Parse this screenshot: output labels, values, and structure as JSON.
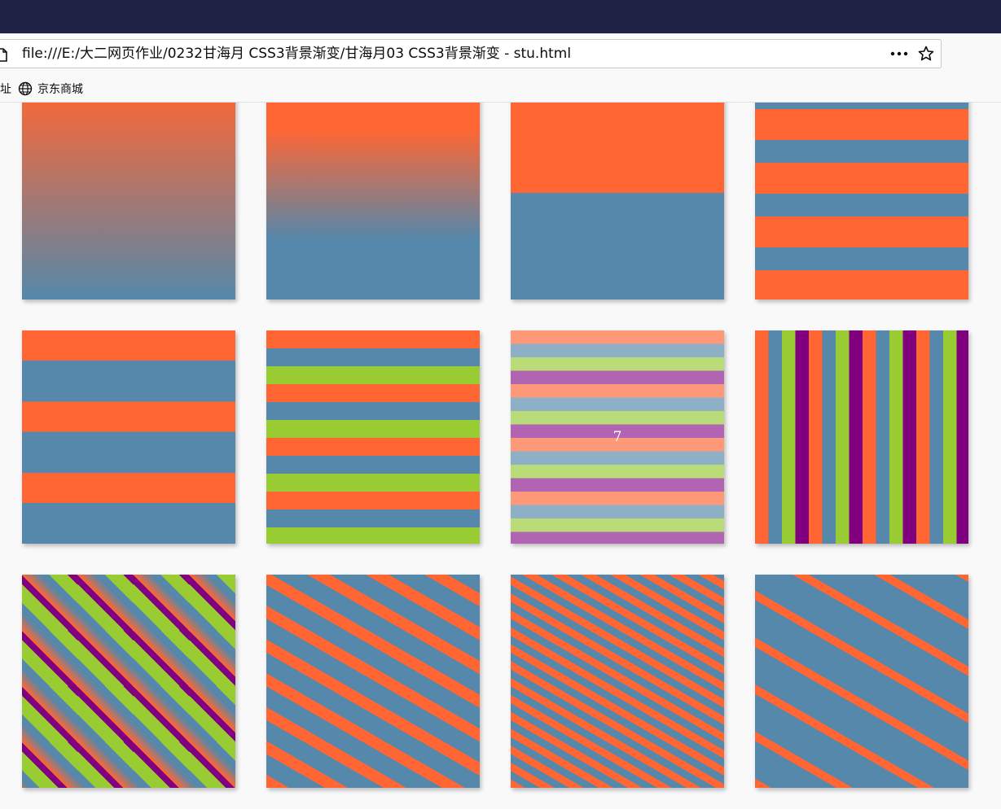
{
  "browser": {
    "address": "file:///E:/大二网页作业/0232甘海月 CSS3背景渐变/甘海月03 CSS3背景渐变 - stu.html",
    "bookmark_partial": "址",
    "bookmarks": [
      {
        "label": "京东商城",
        "icon": "globe-icon"
      }
    ]
  },
  "page": {
    "boxes": [
      {
        "label": ""
      },
      {
        "label": ""
      },
      {
        "label": ""
      },
      {
        "label": ""
      },
      {
        "label": ""
      },
      {
        "label": ""
      },
      {
        "label": "7"
      },
      {
        "label": ""
      },
      {
        "label": ""
      },
      {
        "label": ""
      },
      {
        "label": ""
      },
      {
        "label": ""
      }
    ]
  },
  "colors": {
    "orange": "#ff6633",
    "blue": "#5588aa",
    "green": "#99cc33",
    "purple": "#800080",
    "titlebar": "#1f2244"
  }
}
